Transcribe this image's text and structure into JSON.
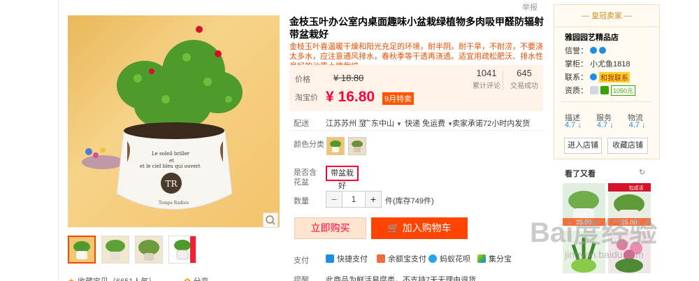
{
  "top": {
    "report": "举报"
  },
  "product": {
    "title": "金枝玉叶办公室内桌面趣味小盆栽绿植物多肉吸甲醛防辐射带盆栽好",
    "subtitle": "金枝玉叶喜温暖干燥和阳光充足的环境，耐半阴。耐干旱，不耐涝，不要浇太多水，应注意通风排水，春秋季等干透再浇透。适宜用疏松肥沃、排水性良好的沙质土壤栽培。",
    "image_text_1": "Le soleil briller",
    "image_text_2": "et",
    "image_text_3": "et le ciel bleu qui ouvert",
    "image_brand": "Temps Radieu"
  },
  "price": {
    "label": "价格",
    "original": "¥ 18.80",
    "promo_label": "淘宝价",
    "promo": "¥ 16.80",
    "promo_badge": "9月特卖",
    "reviews_count": "1041",
    "reviews_label": "累计评论",
    "sales_count": "645",
    "sales_label": "交易成功"
  },
  "delivery": {
    "label": "配送",
    "from": "江苏苏州 至",
    "to": "广东中山",
    "shipping": "快递 免运费",
    "promise": "卖家承诺72小时内发货"
  },
  "color": {
    "label": "颜色分类"
  },
  "option": {
    "label": "是否含花盆",
    "selected": "带盆栽好"
  },
  "quantity": {
    "label": "数量",
    "value": "1",
    "minus": "−",
    "plus": "+",
    "stock": "件(库存749件)"
  },
  "actions": {
    "buy": "立即购买",
    "cart": "加入购物车"
  },
  "payment": {
    "label": "支付",
    "methods": [
      "快捷支付",
      "余额宝支付",
      "蚂蚁花呗",
      "集分宝"
    ]
  },
  "reminder": {
    "label": "提醒",
    "text": "此商品为鲜活易腐类，不支持7天无理由退货"
  },
  "gallery": {
    "favorite": "收藏宝贝（6651人气）",
    "share": "分享"
  },
  "seller": {
    "badge": "皇冠卖家",
    "name": "雅园园艺精品店",
    "credit_label": "信誉：",
    "keeper_label": "掌柜：",
    "keeper": "小尤鱼1818",
    "contact_label": "联系：",
    "contact": "和我联系",
    "cert_label": "资质：",
    "deposit": "1050元",
    "scores": [
      {
        "label": "描述",
        "value": "4.7 ↓"
      },
      {
        "label": "服务",
        "value": "4.7 ↓"
      },
      {
        "label": "物流",
        "value": "4.7 ↓"
      }
    ],
    "enter_shop": "进入店铺",
    "favorite_shop": "收藏店铺"
  },
  "recommend": {
    "title": "看了又看",
    "price_1": "35.00",
    "tag_2": "包成活",
    "price_2": "25.00"
  },
  "watermark": {
    "main": "Bai度经验",
    "sub": "jingyan.baidu.com"
  },
  "colors": {
    "accent": "#ff4400",
    "price_red": "#ff0036",
    "panel_bg": "#fff2e8",
    "seller_gold": "#c78c1d"
  }
}
